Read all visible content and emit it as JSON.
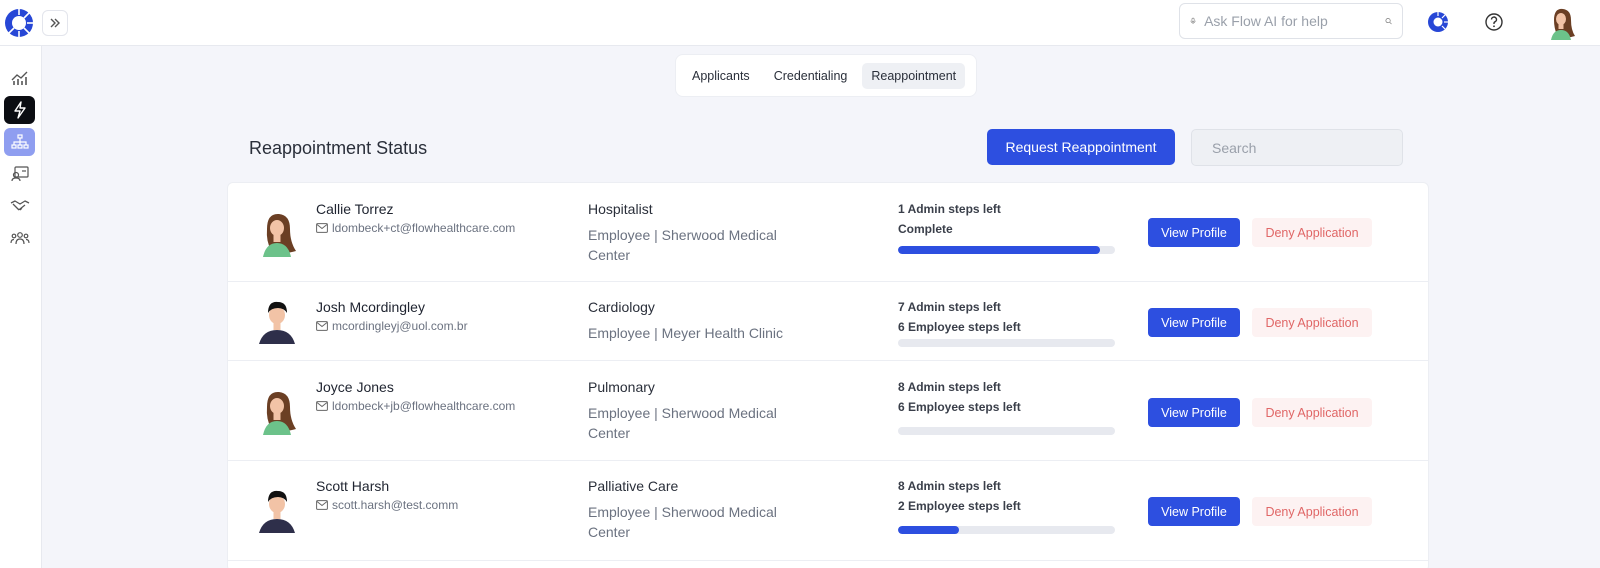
{
  "topbar": {
    "ai_search_placeholder": "Ask Flow AI for help"
  },
  "tabs": [
    {
      "label": "Applicants",
      "active": false
    },
    {
      "label": "Credentialing",
      "active": false
    },
    {
      "label": "Reappointment",
      "active": true
    }
  ],
  "page": {
    "title": "Reappointment Status",
    "request_button": "Request Reappointment",
    "search_placeholder": "Search"
  },
  "colors": {
    "primary": "#2d4fe0",
    "deny_text": "#e06666",
    "deny_bg": "#fdf2f2"
  },
  "rows": [
    {
      "name": "Callie Torrez",
      "email": "ldombeck+ct@flowhealthcare.com",
      "specialty": "Hospitalist",
      "employer": "Employee | Sherwood Medical Center",
      "steps1": "1 Admin steps left",
      "steps2": "Complete",
      "progress": 0.93,
      "avatar": "female-avatar-icon",
      "view": "View Profile",
      "deny": "Deny Application"
    },
    {
      "name": "Josh Mcordingley",
      "email": "mcordingleyj@uol.com.br",
      "specialty": "Cardiology",
      "employer": "Employee | Meyer Health Clinic",
      "steps1": "7 Admin steps left",
      "steps2": "6 Employee steps left",
      "progress": 0,
      "avatar": "male-avatar-icon",
      "view": "View Profile",
      "deny": "Deny Application"
    },
    {
      "name": "Joyce Jones",
      "email": "ldombeck+jb@flowhealthcare.com",
      "specialty": "Pulmonary",
      "employer": "Employee | Sherwood Medical Center",
      "steps1": "8 Admin steps left",
      "steps2": "6 Employee steps left",
      "progress": 0,
      "avatar": "female-avatar-icon",
      "view": "View Profile",
      "deny": "Deny Application"
    },
    {
      "name": "Scott Harsh",
      "email": "scott.harsh@test.comm",
      "specialty": "Palliative Care",
      "employer": "Employee | Sherwood Medical Center",
      "steps1": "8 Admin steps left",
      "steps2": "2 Employee steps left",
      "progress": 0.28,
      "avatar": "male-avatar-icon",
      "view": "View Profile",
      "deny": "Deny Application"
    }
  ]
}
